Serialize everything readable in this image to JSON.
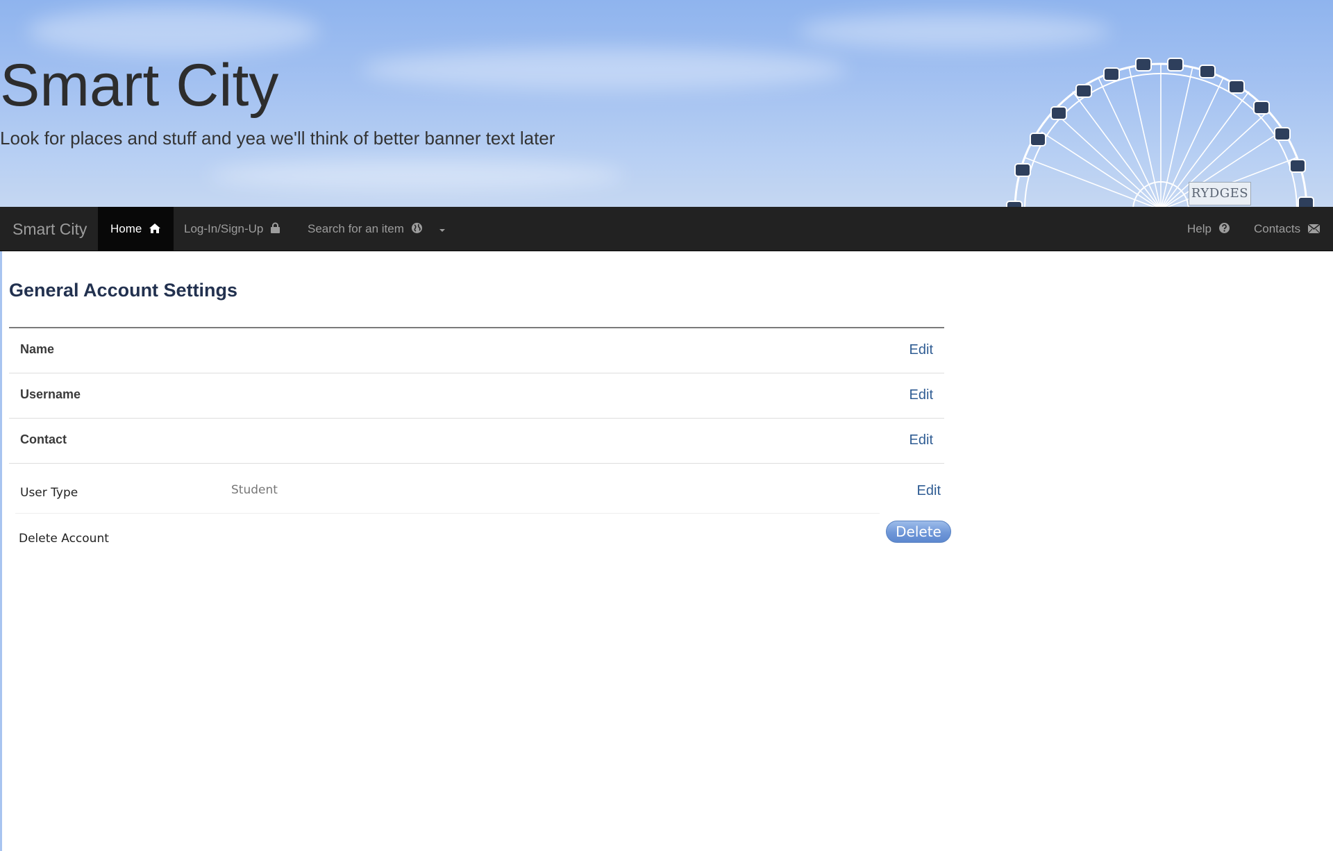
{
  "banner": {
    "title": "Smart City",
    "subtitle": "Look for places and stuff and yea we'll think of better banner text later",
    "sign_text": "RYDGES"
  },
  "navbar": {
    "brand": "Smart City",
    "items": [
      {
        "label": "Home",
        "icon": "home-icon",
        "active": true
      },
      {
        "label": "Log-In/Sign-Up",
        "icon": "lock-icon"
      },
      {
        "label": "Search for an item",
        "icon": "globe-icon",
        "dropdown": true
      },
      {
        "label": "Help",
        "icon": "question-circle-icon"
      },
      {
        "label": "Contacts",
        "icon": "envelope-icon"
      }
    ]
  },
  "settings": {
    "title": "General Account Settings",
    "rows": [
      {
        "label": "Name",
        "value": "",
        "action": "Edit"
      },
      {
        "label": "Username",
        "value": "",
        "action": "Edit"
      },
      {
        "label": "Contact",
        "value": "",
        "action": "Edit"
      },
      {
        "label": "User Type",
        "value": "Student",
        "action": "Edit"
      }
    ],
    "delete": {
      "label": "Delete Account",
      "button": "Delete"
    }
  },
  "colors": {
    "navbar_bg": "#222222",
    "navbar_active_bg": "#080808",
    "link": "#2f5c93",
    "delete_button": "#6f97d8",
    "sky": "#a3c1f1"
  }
}
